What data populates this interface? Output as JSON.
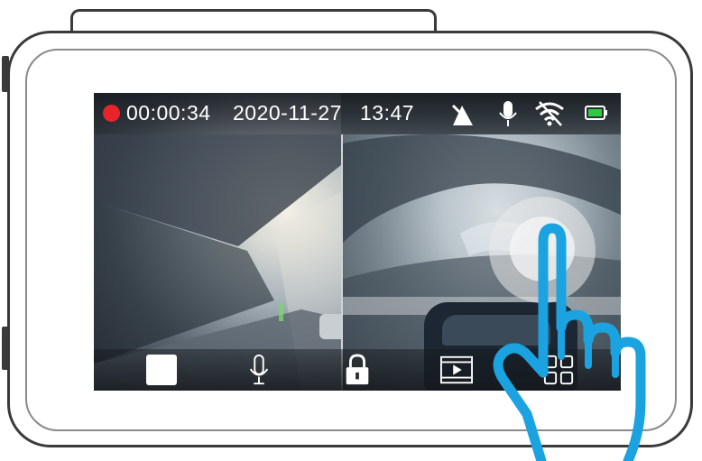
{
  "status_bar": {
    "recording_indicator": "recording-dot",
    "elapsed_time": "00:00:34",
    "date": "2020-11-27",
    "time": "13:47",
    "icons": [
      "gps-satellite-icon",
      "microphone-icon",
      "wifi-icon",
      "battery-icon"
    ],
    "rec_color": "#e8232a",
    "battery_color": "#2ecc40"
  },
  "toolbar": {
    "buttons": [
      "stop-record-button",
      "microphone-button",
      "lock-button",
      "playback-button",
      "menu-grid-button"
    ]
  },
  "colors": {
    "device_outline": "#3a3a3a",
    "hand_stroke": "#1aa3e0",
    "screen_overlay": "#14181c"
  }
}
